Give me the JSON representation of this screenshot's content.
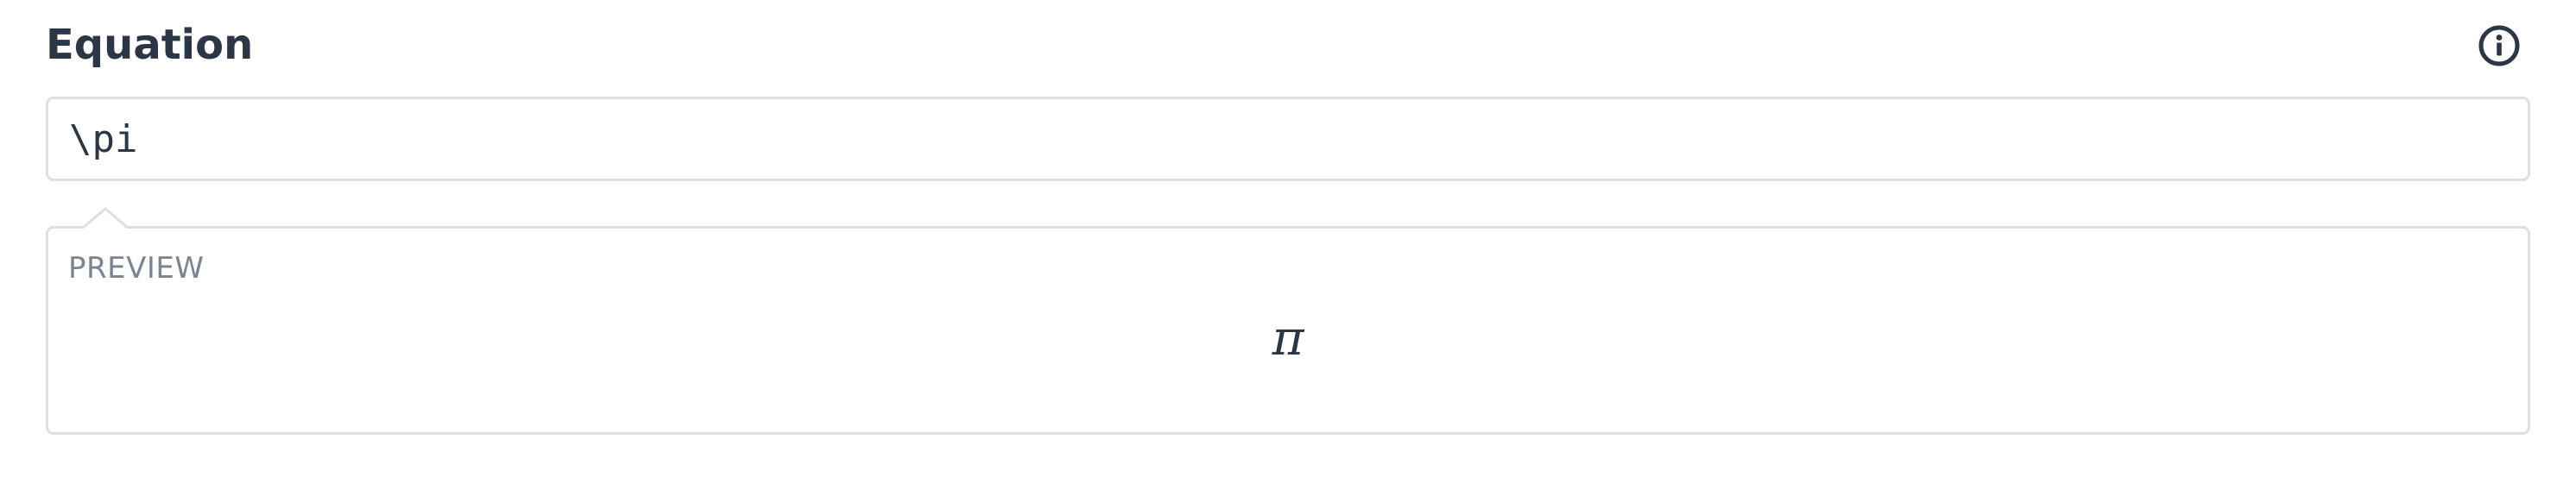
{
  "equation_field": {
    "title": "Equation",
    "info_icon": "info-circle-icon",
    "input_value": "\\pi"
  },
  "preview": {
    "label": "PREVIEW",
    "rendered": "π"
  },
  "colors": {
    "text": "#2b3746",
    "muted": "#7a8594",
    "border": "#dcdfe3",
    "background": "#ffffff"
  }
}
